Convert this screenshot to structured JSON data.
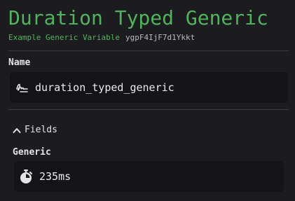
{
  "header": {
    "title": "Duration Typed Generic",
    "type_label": "Example Generic Variable",
    "id": "ygpF4IjF7d1Ykkt"
  },
  "name_section": {
    "label": "Name",
    "value": "duration_typed_generic",
    "icon": "signature-icon"
  },
  "fields_section": {
    "toggle_label": "Fields",
    "expanded": true
  },
  "generic_field": {
    "label": "Generic",
    "value": "235ms",
    "icon": "stopwatch-icon"
  },
  "colors": {
    "accent": "#4fb55a",
    "background": "#1c1b1f",
    "box": "#141317"
  }
}
